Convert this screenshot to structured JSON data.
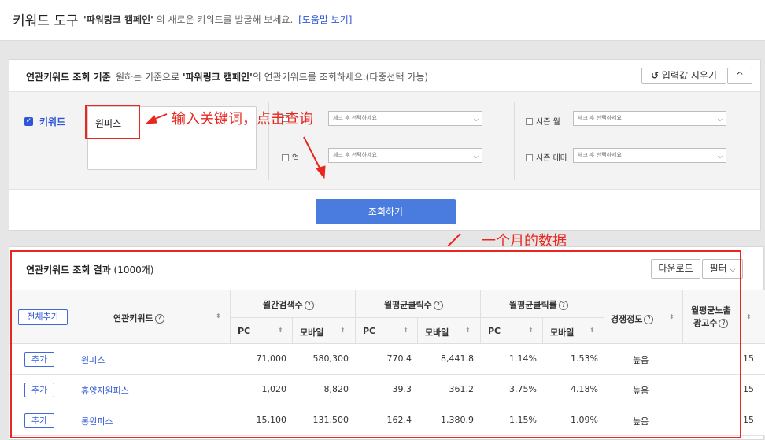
{
  "header": {
    "title": "키워드 도구",
    "campaign_name": "'파워링크 캠페인'",
    "subtitle": "의 새로운 키워드를 발굴해 보세요.",
    "help_link": "[도움말 보기]"
  },
  "criteria": {
    "title": "연관키워드 조회 기준",
    "desc_prefix": "원하는 기준으로",
    "desc_campaign": "'파워링크 캠페인'",
    "desc_suffix": "의 연관키워드를 조회하세요.(다중선택 가능)",
    "clear_button": "입력값 지우기",
    "collapse_button": "^",
    "keyword_label": "키워드",
    "keyword_value": "원피스",
    "opt_website_label": "",
    "opt_industry_label": "업",
    "opt_season_month_label": "시즌 월",
    "opt_season_theme_label": "시즌 테마",
    "select_placeholder": "체크 후 선택하세요",
    "search_button": "조회하기"
  },
  "results": {
    "title": "연관키워드 조회 결과",
    "count": "(1000개)",
    "download_button": "다운로드",
    "filter_button": "필터",
    "add_all_button": "전체추가",
    "col_keyword": "연관키워드",
    "col_monthly_search": "월간검색수",
    "col_monthly_click": "월평균클릭수",
    "col_monthly_ctr": "월평균클릭률",
    "col_competition": "경쟁정도",
    "col_ad_count_1": "월평균노출",
    "col_ad_count_2": "광고수",
    "sub_pc": "PC",
    "sub_mobile": "모바일",
    "add_button": "추가",
    "rows": [
      {
        "keyword": "원피스",
        "search_pc": "71,000",
        "search_mobile": "580,300",
        "click_pc": "770.4",
        "click_mobile": "8,441.8",
        "ctr_pc": "1.14%",
        "ctr_mobile": "1.53%",
        "competition": "높음",
        "ad_count": "15"
      },
      {
        "keyword": "휴양지원피스",
        "search_pc": "1,020",
        "search_mobile": "8,820",
        "click_pc": "39.3",
        "click_mobile": "361.2",
        "ctr_pc": "3.75%",
        "ctr_mobile": "4.18%",
        "competition": "높음",
        "ad_count": "15"
      },
      {
        "keyword": "롱원피스",
        "search_pc": "15,100",
        "search_mobile": "131,500",
        "click_pc": "162.4",
        "click_mobile": "1,380.9",
        "ctr_pc": "1.15%",
        "ctr_mobile": "1.09%",
        "competition": "높음",
        "ad_count": "15"
      }
    ]
  },
  "annotations": {
    "input_hint": "输入关键词，点击查询",
    "month_hint": "一个月的数据"
  },
  "colors": {
    "accent": "#2f56d8",
    "search_button": "#4a7ce0",
    "annotation_red": "#e8271f"
  }
}
